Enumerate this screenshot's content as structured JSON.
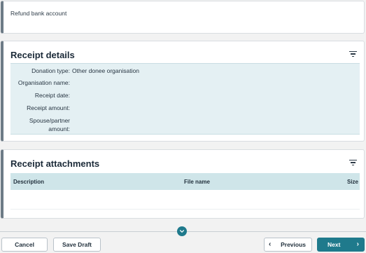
{
  "refund": {
    "label": "Refund bank account"
  },
  "receipt_details": {
    "title": "Receipt details",
    "rows": [
      {
        "label": "Donation type:",
        "value": "Other donee organisation"
      },
      {
        "label": "Organisation name:",
        "value": ""
      },
      {
        "label": "Receipt date:",
        "value": ""
      },
      {
        "label": "Receipt amount:",
        "value": ""
      },
      {
        "label_line1": "Spouse/partner",
        "label_line2": "amount:",
        "value": ""
      }
    ]
  },
  "receipt_attachments": {
    "title": "Receipt attachments",
    "columns": [
      "Description",
      "File name",
      "Size"
    ]
  },
  "footer": {
    "cancel_label": "Cancel",
    "save_draft_label": "Save Draft",
    "previous_label": "Previous",
    "next_label": "Next"
  },
  "icons": {
    "filter": "filter-icon",
    "collapse": "chevron-down-icon",
    "previous": "chevron-left-icon",
    "next": "chevron-right-icon"
  },
  "colors": {
    "accent": "#1f7a8c",
    "panel_bg": "#e4f0f3",
    "table_head_bg": "#cfe5e9"
  }
}
